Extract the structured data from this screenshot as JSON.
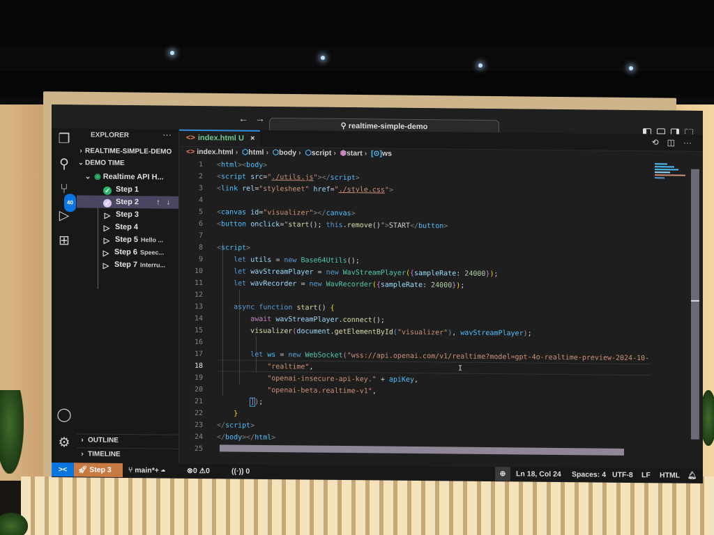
{
  "window": {
    "command_center": "realtime-simple-demo",
    "nav_back": "←",
    "nav_forward": "→"
  },
  "activity_bar": {
    "source_control_badge": "40"
  },
  "sidebar": {
    "title": "EXPLORER",
    "more": "···",
    "sections": [
      {
        "label": "REALTIME-SIMPLE-DEMO",
        "expanded": false
      },
      {
        "label": "DEMO TIME",
        "expanded": true
      }
    ],
    "tour": {
      "label": "Realtime API H...",
      "steps": [
        {
          "label": "Step 1",
          "desc": "",
          "state": "done"
        },
        {
          "label": "Step 2",
          "desc": "",
          "state": "selected"
        },
        {
          "label": "Step 3",
          "desc": "",
          "state": "pending"
        },
        {
          "label": "Step 4",
          "desc": "",
          "state": "pending"
        },
        {
          "label": "Step 5",
          "desc": "Hello ...",
          "state": "pending"
        },
        {
          "label": "Step 6",
          "desc": "Speec...",
          "state": "pending"
        },
        {
          "label": "Step 7",
          "desc": "Interru...",
          "state": "pending"
        }
      ]
    },
    "outline": "OUTLINE",
    "timeline": "TIMELINE"
  },
  "editor": {
    "tab": {
      "filename": "index.html",
      "status": "U",
      "close": "×"
    },
    "breadcrumb": [
      "index.html",
      "html",
      "body",
      "script",
      "start",
      "ws"
    ],
    "current_line": 18,
    "lines": [
      "1",
      "2",
      "3",
      "4",
      "5",
      "6",
      "7",
      "8",
      "9",
      "10",
      "11",
      "12",
      "13",
      "14",
      "15",
      "16",
      "17",
      "18",
      "19",
      "20",
      "21",
      "22",
      "23",
      "24",
      "25"
    ],
    "code": {
      "l1_html": "html",
      "l1_body": "body",
      "l2_tag": "script",
      "l2_attr": "src",
      "l2_val": "./utils.js",
      "l3_tag": "link",
      "l3_attr1": "rel",
      "l3_val1": "\"stylesheet\"",
      "l3_attr2": "href",
      "l3_val2": "./style.css",
      "l5_tag": "canvas",
      "l5_attr": "id",
      "l5_val": "\"visualizer\"",
      "l6_tag": "button",
      "l6_attr": "onclick",
      "l6_fn": "start",
      "l6_this": "this",
      "l6_method": "remove",
      "l6_text": "START",
      "l8_tag": "script",
      "l9": {
        "kw": "let",
        "var": "utils",
        "new": "new",
        "cls": "Base64Utils"
      },
      "l10": {
        "kw": "let",
        "var": "wavStreamPlayer",
        "new": "new",
        "cls": "WavStreamPlayer",
        "prop": "sampleRate",
        "num": "24000"
      },
      "l11": {
        "kw": "let",
        "var": "wavRecorder",
        "new": "new",
        "cls": "WavRecorder",
        "prop": "sampleRate",
        "num": "24000"
      },
      "l13": {
        "async": "async",
        "function": "function",
        "name": "start"
      },
      "l14": {
        "await": "await",
        "obj": "wavStreamPlayer",
        "method": "connect"
      },
      "l15": {
        "fn": "visualizer",
        "obj": "document",
        "method": "getElementById",
        "arg": "\"visualizer\"",
        "arg2": "wavStreamPlayer"
      },
      "l17": {
        "kw": "let",
        "var": "ws",
        "new": "new",
        "cls": "WebSocket",
        "url": "\"wss://api.openai.com/v1/realtime?model=gpt-4o-realtime-preview-2024-10-"
      },
      "l18": "\"realtime\"",
      "l19": {
        "str": "\"openai-insecure-api-key.\"",
        "var": "apiKey"
      },
      "l20": "\"openai-beta.realtime-v1\"",
      "l23_tag": "script",
      "l24_body": "body",
      "l24_html": "html"
    }
  },
  "statusbar": {
    "remote": "><",
    "step": "Step 3",
    "branch": "main*+",
    "errors": "0",
    "warnings": "0",
    "ports": "0",
    "position": "Ln 18, Col 24",
    "spaces": "Spaces: 4",
    "encoding": "UTF-8",
    "eol": "LF",
    "language": "HTML"
  }
}
